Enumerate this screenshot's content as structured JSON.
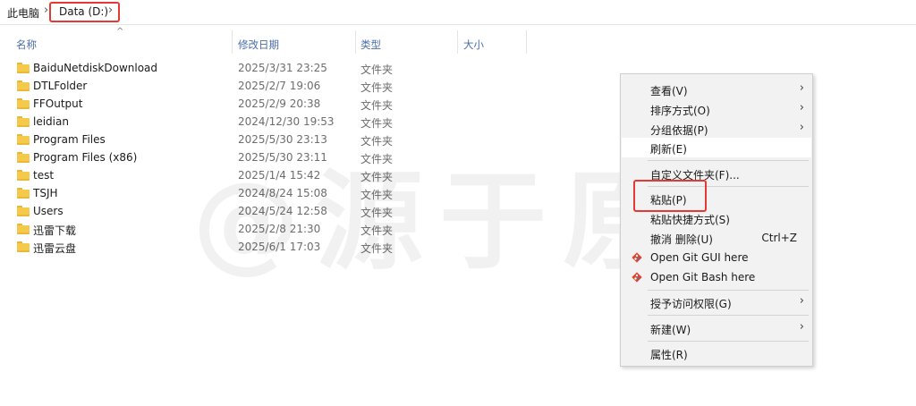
{
  "breadcrumb": {
    "root": "此电脑",
    "drive": "Data (D:)"
  },
  "columns": {
    "name": "名称",
    "date": "修改日期",
    "type": "类型",
    "size": "大小"
  },
  "files": [
    {
      "name": "BaiduNetdiskDownload",
      "date": "2025/3/31 23:25",
      "type": "文件夹"
    },
    {
      "name": "DTLFolder",
      "date": "2025/2/7 19:06",
      "type": "文件夹"
    },
    {
      "name": "FFOutput",
      "date": "2025/2/9 20:38",
      "type": "文件夹"
    },
    {
      "name": "leidian",
      "date": "2024/12/30 19:53",
      "type": "文件夹"
    },
    {
      "name": "Program Files",
      "date": "2025/5/30 23:13",
      "type": "文件夹"
    },
    {
      "name": "Program Files (x86)",
      "date": "2025/5/30 23:11",
      "type": "文件夹"
    },
    {
      "name": "test",
      "date": "2025/1/4 15:42",
      "type": "文件夹"
    },
    {
      "name": "TSJH",
      "date": "2024/8/24 15:08",
      "type": "文件夹"
    },
    {
      "name": "Users",
      "date": "2024/5/24 12:58",
      "type": "文件夹"
    },
    {
      "name": "迅雷下载",
      "date": "2025/2/8 21:30",
      "type": "文件夹"
    },
    {
      "name": "迅雷云盘",
      "date": "2025/6/1 17:03",
      "type": "文件夹"
    }
  ],
  "watermark": "@源于原",
  "context_menu": {
    "view": "查看(V)",
    "sort": "排序方式(O)",
    "group": "分组依据(P)",
    "refresh": "刷新(E)",
    "customize": "自定义文件夹(F)...",
    "paste": "粘贴(P)",
    "paste_shortcut": "粘贴快捷方式(S)",
    "undo": "撤消 删除(U)",
    "undo_shortcut": "Ctrl+Z",
    "git_gui": "Open Git GUI here",
    "git_bash": "Open Git Bash here",
    "grant_access": "授予访问权限(G)",
    "new": "新建(W)",
    "properties": "属性(R)"
  },
  "colors": {
    "highlight_red": "#e53935",
    "folder_yellow": "#f5c94b",
    "header_blue": "#4a6ea9"
  }
}
